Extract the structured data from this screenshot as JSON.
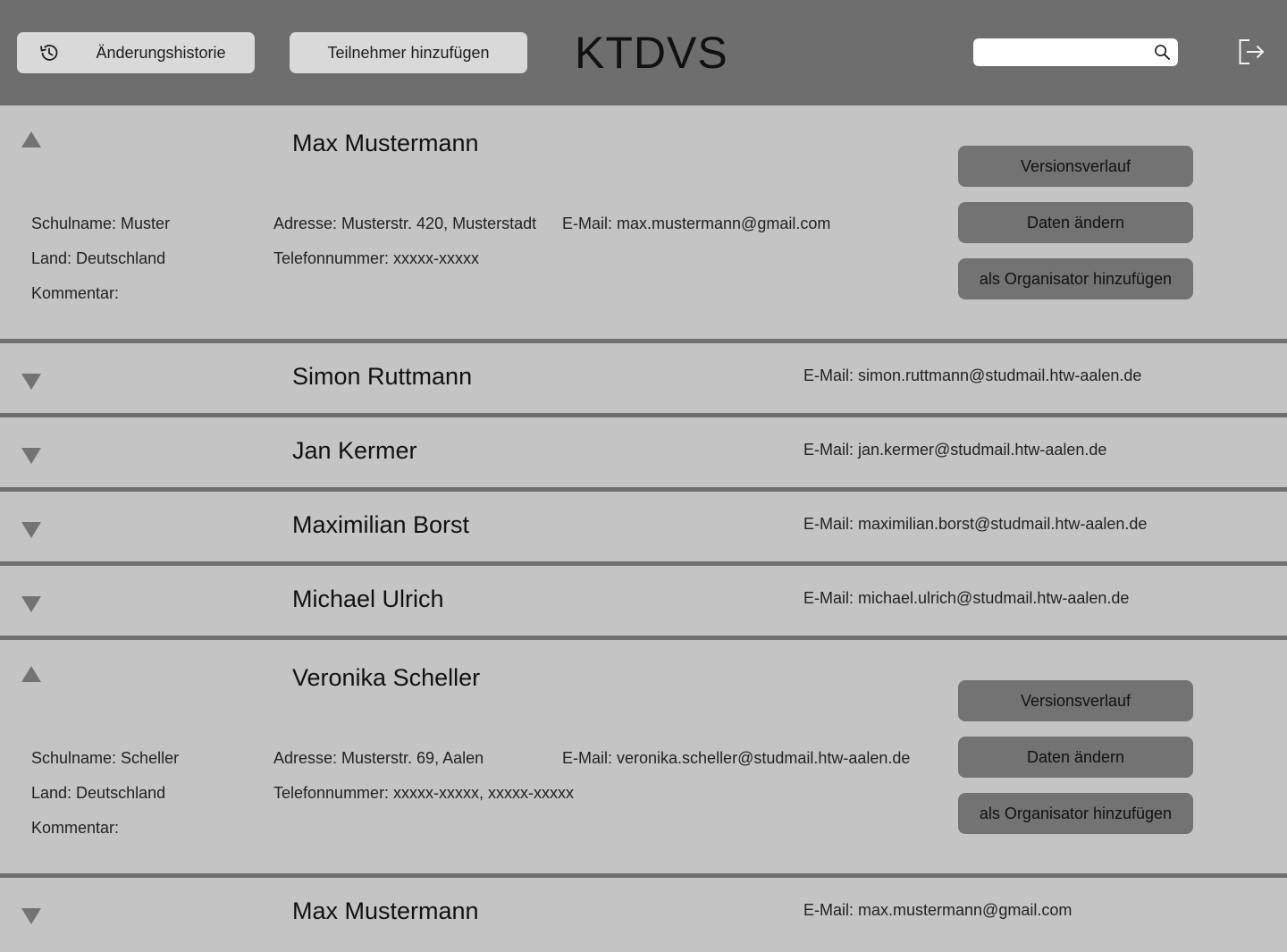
{
  "header": {
    "history_label": "Änderungshistorie",
    "add_label": "Teilnehmer hinzufügen",
    "app_title": "KTDVS",
    "search_value": "",
    "search_placeholder": ""
  },
  "labels": {
    "school": "Schulname: ",
    "address": "Adresse: ",
    "email": "E-Mail: ",
    "country": "Land: ",
    "phone": "Telefonnummer: ",
    "comment": "Kommentar:"
  },
  "actions": {
    "versions": "Versionsverlauf",
    "edit": "Daten ändern",
    "organizer": "als Organisator hinzufügen"
  },
  "participants": [
    {
      "name": "Max Mustermann",
      "expanded": true,
      "email_line": "E-Mail: max.mustermann@gmail.com",
      "school_line": "Schulname: Muster",
      "address_line": "Adresse: Musterstr. 420, Musterstadt",
      "country_line": "Land: Deutschland",
      "phone_line": "Telefonnummer: xxxxx-xxxxx",
      "comment_line": "Kommentar:"
    },
    {
      "name": "Simon Ruttmann",
      "expanded": false,
      "email_line": "E-Mail: simon.ruttmann@studmail.htw-aalen.de"
    },
    {
      "name": "Jan Kermer",
      "expanded": false,
      "email_line": "E-Mail: jan.kermer@studmail.htw-aalen.de"
    },
    {
      "name": "Maximilian Borst",
      "expanded": false,
      "email_line": "E-Mail: maximilian.borst@studmail.htw-aalen.de"
    },
    {
      "name": "Michael Ulrich",
      "expanded": false,
      "email_line": "E-Mail: michael.ulrich@studmail.htw-aalen.de"
    },
    {
      "name": "Veronika Scheller",
      "expanded": true,
      "email_line": "E-Mail: veronika.scheller@studmail.htw-aalen.de",
      "school_line": "Schulname: Scheller",
      "address_line": "Adresse: Musterstr. 69, Aalen",
      "country_line": "Land: Deutschland",
      "phone_line": "Telefonnummer: xxxxx-xxxxx, xxxxx-xxxxx",
      "comment_line": "Kommentar:"
    },
    {
      "name": "Max Mustermann",
      "expanded": false,
      "email_line": "E-Mail: max.mustermann@gmail.com"
    }
  ],
  "colors": {
    "header_bg": "#6e6e6e",
    "list_bg": "#c4c4c4",
    "divider": "#707070",
    "action_button": "#737373",
    "header_button": "#d9d9d9"
  }
}
